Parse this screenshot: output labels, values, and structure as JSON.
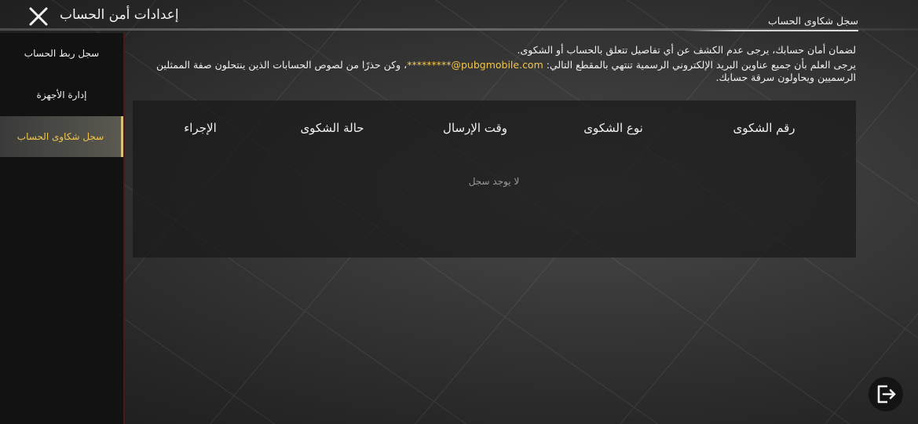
{
  "header": {
    "title": "إعدادات أمن الحساب",
    "close_icon": "close-icon"
  },
  "sidebar": {
    "items": [
      {
        "label": "سجل ربط الحساب",
        "active": false
      },
      {
        "label": "إدارة الأجهزة",
        "active": false
      },
      {
        "label": "سجل شكاوى الحساب",
        "active": true
      }
    ]
  },
  "main": {
    "section_title": "سجل شكاوى الحساب",
    "notice_line1": "لضمان أمان حسابك، يرجى عدم الكشف عن أي تفاصيل تتعلق بالحساب أو الشكوى.",
    "notice_line2_prefix": "يرجى العلم بأن جميع عناوين البريد الإلكتروني الرسمية تنتهي بالمقطع التالي: ",
    "notice_email": "*********@pubgmobile.com",
    "notice_line2_suffix": "، وكن حذرًا من لصوص الحسابات الذين ينتحلون صفة الممثلين الرسميين ويحاولون سرقة حسابك.",
    "table": {
      "columns": [
        "رقم الشكوى",
        "نوع الشكوى",
        "وقت الإرسال",
        "حالة الشكوى",
        "الإجراء"
      ],
      "empty_text": "لا يوجد سجل"
    }
  },
  "footer": {
    "exit_icon": "exit-icon"
  },
  "colors": {
    "accent": "#f3c64a",
    "sidebar_bg": "#121212",
    "table_bg": "#191919"
  }
}
